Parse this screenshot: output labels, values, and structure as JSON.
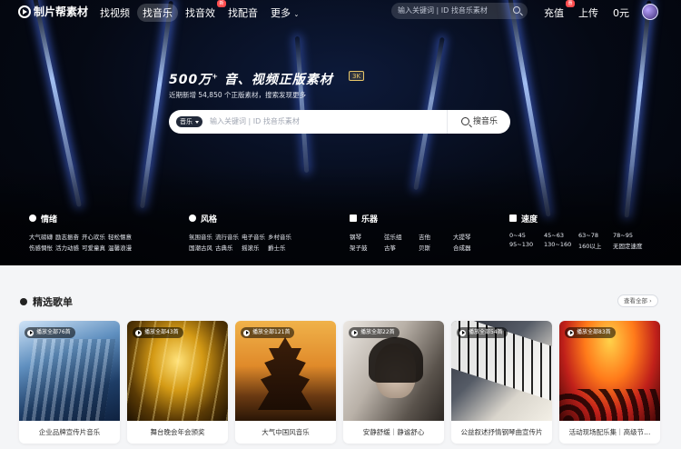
{
  "brand": {
    "name": "制片帮素材"
  },
  "nav": {
    "items": [
      {
        "label": "找视频",
        "active": false,
        "new": false
      },
      {
        "label": "找音乐",
        "active": true,
        "new": false
      },
      {
        "label": "找音效",
        "active": false,
        "new": true
      },
      {
        "label": "找配音",
        "active": false,
        "new": false
      },
      {
        "label": "更多",
        "active": false,
        "new": false
      }
    ],
    "search_placeholder": "输入关键词 | ID 找音乐素材",
    "recharge": "充值",
    "upload": "上传",
    "balance": "0元"
  },
  "hero": {
    "title_num": "500万",
    "title_sup": "+",
    "title_rest": "音、视频正版素材",
    "tag": "3K",
    "subtitle": "近期新增 54,850 个正版素材，搜索发现更多",
    "search": {
      "category": "音乐",
      "placeholder": "输入关键词 | ID 找音乐素材",
      "button": "搜音乐"
    }
  },
  "categories": [
    {
      "title": "情绪",
      "icon": "mood-icon",
      "items": [
        "大气磅礴",
        "励志振奋",
        "开心欢乐",
        "轻松惬意",
        "伤感惆怅",
        "活力动感",
        "可爱童真",
        "温馨浪漫"
      ]
    },
    {
      "title": "风格",
      "icon": "style-icon",
      "items": [
        "氛围音乐",
        "流行音乐",
        "电子音乐",
        "乡村音乐",
        "国潮古风",
        "古典乐",
        "摇滚乐",
        "爵士乐"
      ]
    },
    {
      "title": "乐器",
      "icon": "instrument-icon",
      "items": [
        "钢琴",
        "弦乐组",
        "吉他",
        "大提琴",
        "架子鼓",
        "古筝",
        "贝斯",
        "合成器"
      ]
    },
    {
      "title": "速度",
      "icon": "tempo-icon",
      "items": [
        "0~45",
        "45~63",
        "63~78",
        "78~95",
        "95~130",
        "130~160",
        "160以上",
        "无固定速度"
      ]
    }
  ],
  "playlists": {
    "title": "精选歌单",
    "see_all": "查看全部 ›",
    "cards": [
      {
        "play": "播放全部76首",
        "label": "企业品牌宣传片音乐"
      },
      {
        "play": "播放全部43首",
        "label": "舞台晚会年会颁奖"
      },
      {
        "play": "播放全部121首",
        "label": "大气中国风音乐"
      },
      {
        "play": "播放全部22首",
        "label": "安静舒缓｜静谧舒心"
      },
      {
        "play": "播放全部54首",
        "label": "公益叙述抒情钢琴曲宣传片"
      },
      {
        "play": "播放全部83首",
        "label": "活动现场配乐集｜高级节..."
      }
    ]
  }
}
